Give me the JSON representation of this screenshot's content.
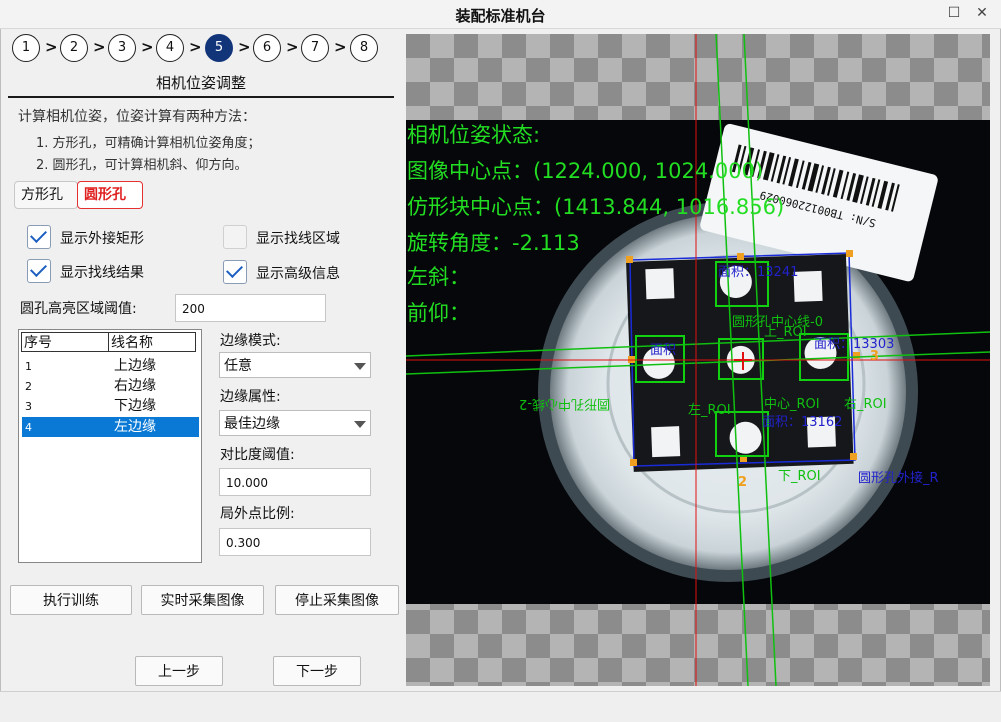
{
  "window": {
    "title": "装配标准机台",
    "maximize_icon": "maximize-icon",
    "close_icon": "close-icon"
  },
  "steps": [
    {
      "label": "1"
    },
    {
      "label": "2"
    },
    {
      "label": "3"
    },
    {
      "label": "4"
    },
    {
      "label": "5",
      "active": true
    },
    {
      "label": "6"
    },
    {
      "label": "7"
    },
    {
      "label": "8"
    }
  ],
  "section_title": "相机位姿调整",
  "description": {
    "line1": "计算相机位姿，位姿计算有两种方法：",
    "line2": "1. 方形孔，可精确计算相机位姿角度；",
    "line3": "2. 圆形孔，可计算相机斜、仰方向。"
  },
  "tabs": {
    "square": "方形孔",
    "circle": "圆形孔",
    "active": "circle"
  },
  "options": {
    "show_bounding_rect": {
      "label": "显示外接矩形",
      "checked": true
    },
    "show_line_region": {
      "label": "显示找线区域",
      "checked": false
    },
    "show_line_result": {
      "label": "显示找线结果",
      "checked": true
    },
    "show_advanced": {
      "label": "显示高级信息",
      "checked": true
    }
  },
  "threshold": {
    "label": "圆孔高亮区域阈值:",
    "value": "200"
  },
  "edge_table": {
    "headers": [
      "序号",
      "线名称"
    ],
    "rows": [
      {
        "index": "1",
        "name": "上边缘"
      },
      {
        "index": "2",
        "name": "右边缘"
      },
      {
        "index": "3",
        "name": "下边缘"
      },
      {
        "index": "4",
        "name": "左边缘",
        "selected": true
      }
    ]
  },
  "edge_settings": {
    "mode_label": "边缘模式:",
    "mode_value": "任意",
    "attr_label": "边缘属性:",
    "attr_value": "最佳边缘",
    "contrast_label": "对比度阈值:",
    "contrast_value": "10.000",
    "outlier_label": "局外点比例:",
    "outlier_value": "0.300"
  },
  "buttons": {
    "train": "执行训练",
    "live": "实时采集图像",
    "stop": "停止采集图像",
    "prev": "上一步",
    "next": "下一步"
  },
  "overlay": {
    "status_title": "相机位姿状态:",
    "image_center": "图像中心点：(1224.000, 1024.000)",
    "block_center": "仿形块中心点：(1413.844, 1016.856)",
    "rotation": "旋转角度：-2.113",
    "left_tilt": "左斜：",
    "front_tilt": "前仰：",
    "text_color": "#22dd22",
    "label_top_roi": "上_ROI",
    "label_bottom_roi": "左_ROI",
    "label_center": "中心_ROI",
    "label_right_roi": "右_ROI",
    "label_lower_roi": "下_ROI",
    "label_circle_center": "圆形孔中心线-0",
    "label_circle_center2": "圆形孔中心线-2",
    "label_circle_outer": "圆形孔外接_R",
    "area_top": "面积：13241",
    "area_right": "面积：13303",
    "area_bottom": "面积：13162",
    "area_left": "面积",
    "barcode_text": "S/N: TB00122060029",
    "marker_2": "2",
    "marker_3": "3"
  }
}
